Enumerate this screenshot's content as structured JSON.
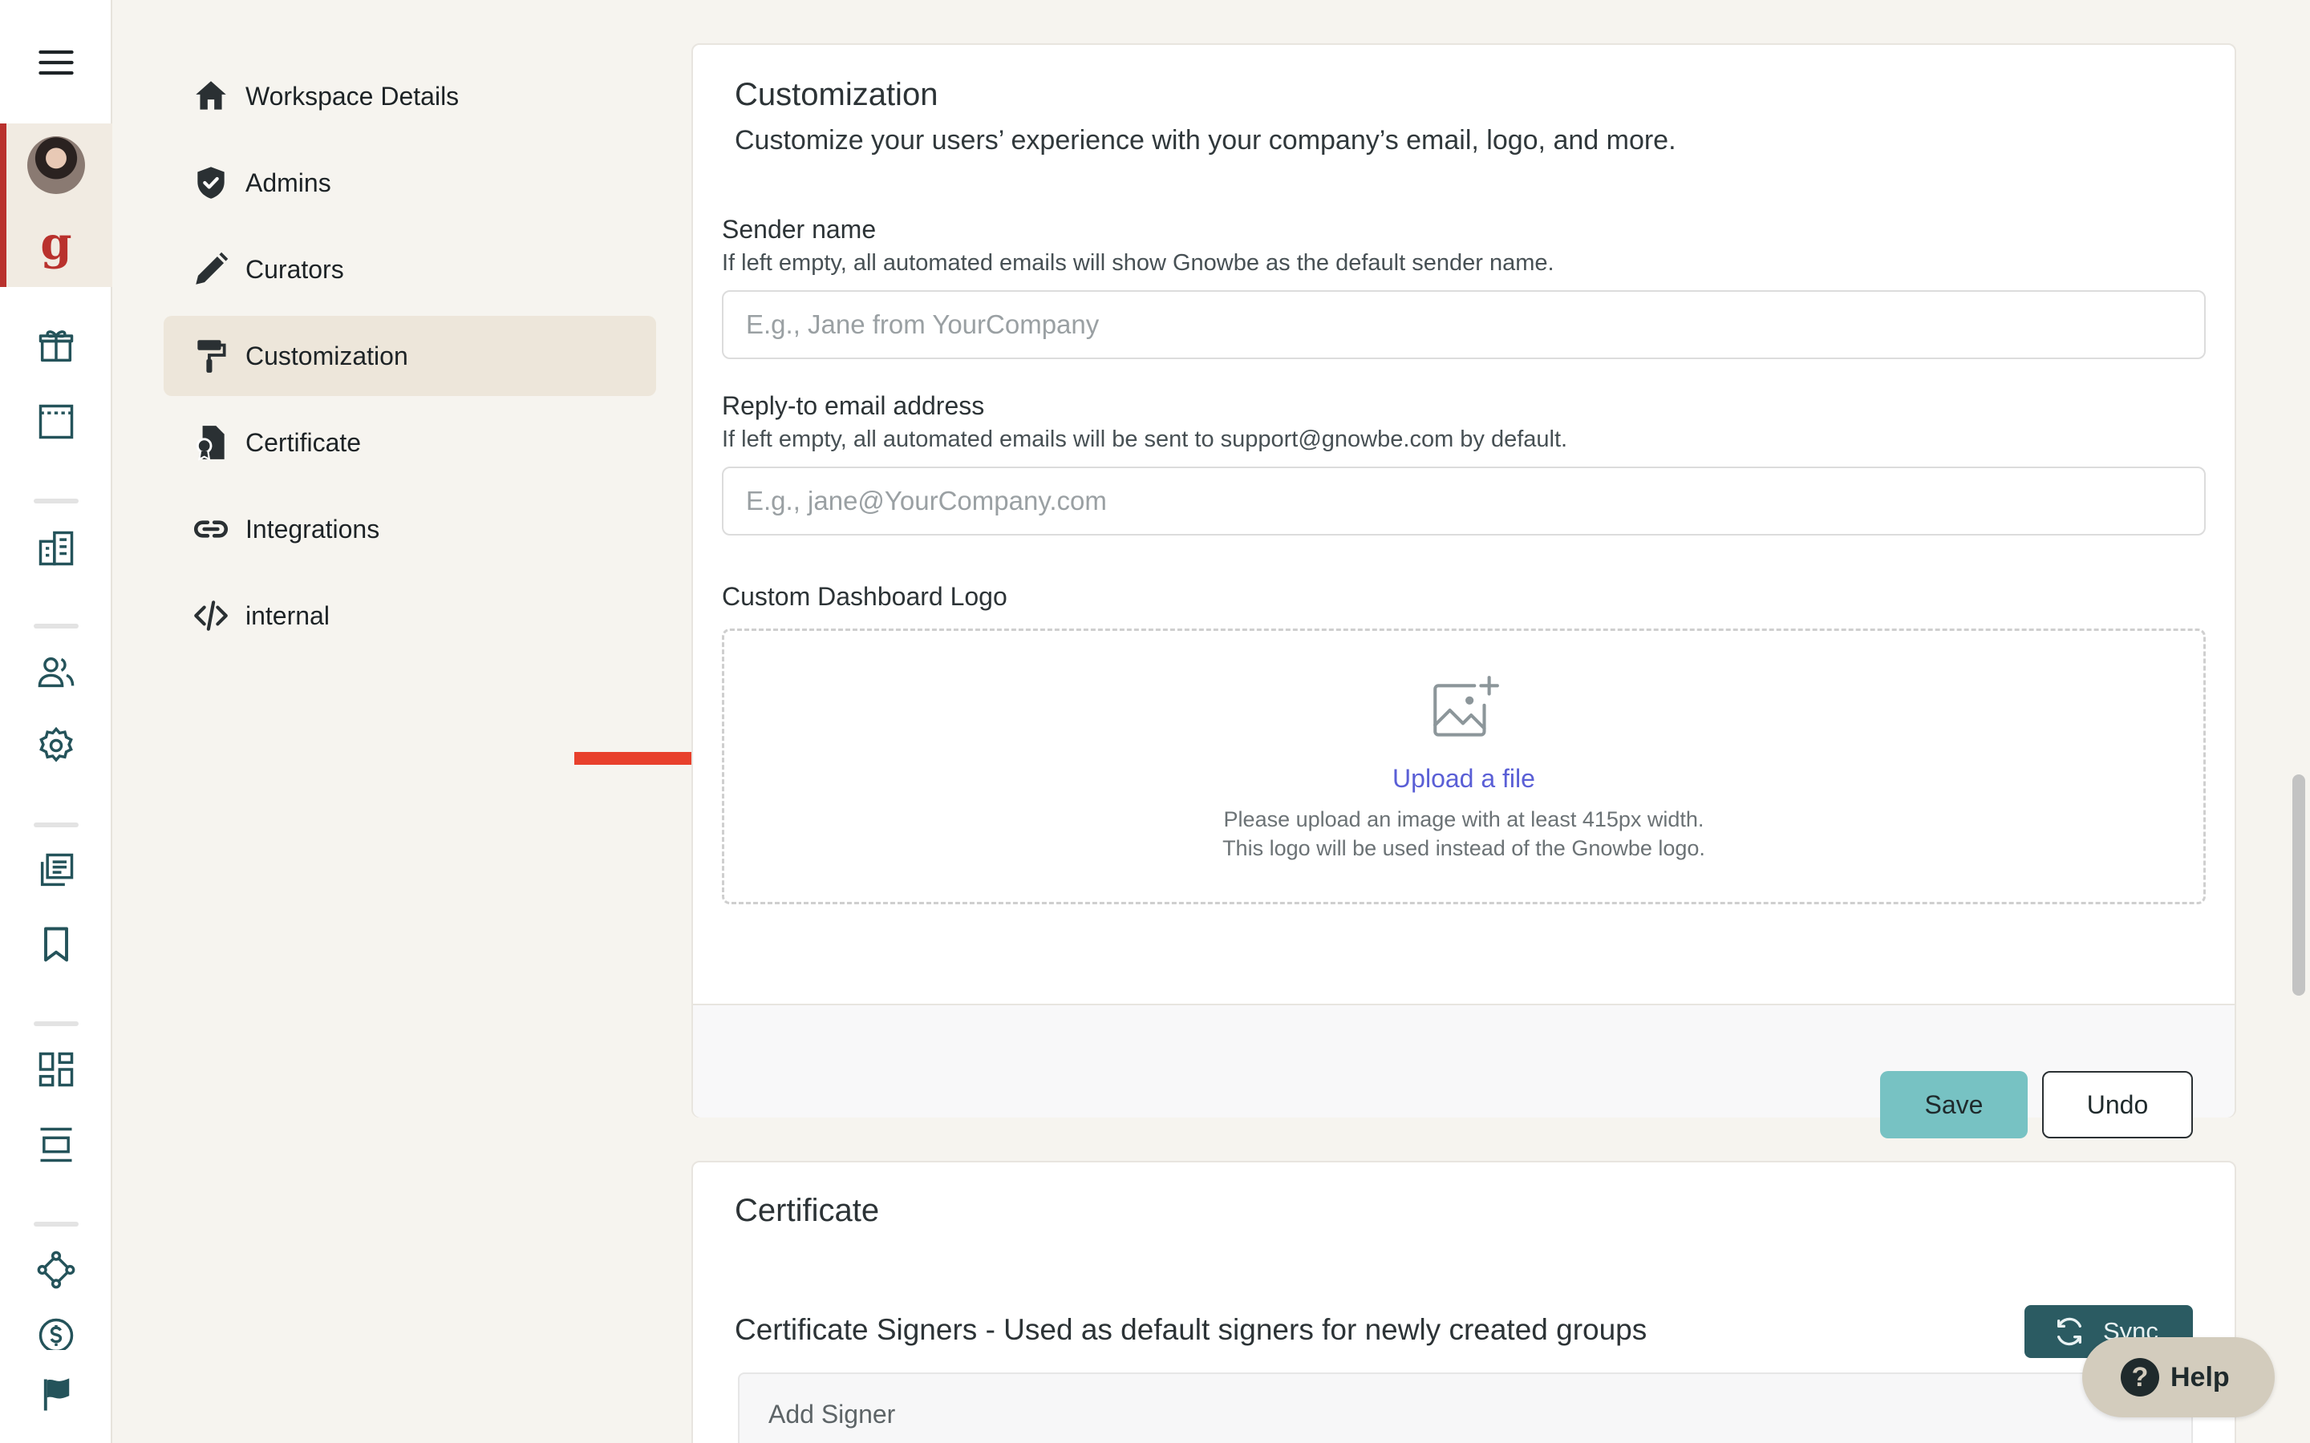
{
  "rail": {
    "icons": [
      "menu-icon",
      "avatar",
      "gnowbe-logo",
      "gift-icon",
      "layout-icon",
      "buildings-icon",
      "users-icon",
      "settings-icon",
      "library-icon",
      "bookmark-icon",
      "dashboard-icon",
      "content-icon",
      "network-icon",
      "billing-icon",
      "flag-icon"
    ],
    "brand_letter": "g"
  },
  "settings_nav": {
    "items": [
      {
        "label": "Workspace Details",
        "icon": "home-icon"
      },
      {
        "label": "Admins",
        "icon": "shield-icon"
      },
      {
        "label": "Curators",
        "icon": "pencil-icon"
      },
      {
        "label": "Customization",
        "icon": "paint-roller-icon",
        "active": true
      },
      {
        "label": "Certificate",
        "icon": "certificate-icon"
      },
      {
        "label": "Integrations",
        "icon": "link-icon"
      },
      {
        "label": "internal",
        "icon": "code-icon"
      }
    ]
  },
  "customization": {
    "title": "Customization",
    "subtitle": "Customize your users’ experience with your company’s email, logo, and more.",
    "sender_name": {
      "label": "Sender name",
      "help": "If left empty, all automated emails will show Gnowbe as the default sender name.",
      "placeholder": "E.g., Jane from YourCompany",
      "value": ""
    },
    "reply_to": {
      "label": "Reply-to email address",
      "help": "If left empty, all automated emails will be sent to support@gnowbe.com by default.",
      "placeholder": "E.g., jane@YourCompany.com",
      "value": ""
    },
    "logo": {
      "label": "Custom Dashboard Logo",
      "upload_link": "Upload a file",
      "hint_line1": "Please upload an image with at least 415px width.",
      "hint_line2": "This logo will be used instead of the Gnowbe logo."
    },
    "save_label": "Save",
    "undo_label": "Undo"
  },
  "certificate": {
    "title": "Certificate",
    "signers_heading": "Certificate Signers - Used as default signers for newly created groups",
    "sync_label": "Sync",
    "add_signer_label": "Add Signer"
  },
  "help": {
    "label": "Help",
    "glyph": "?"
  },
  "colors": {
    "accent_red": "#b9312d",
    "icon_teal": "#24535a",
    "save_button": "#77c2c3",
    "sync_button": "#2b5b62",
    "link": "#5a5fd6",
    "annotation_arrow": "#e8402c"
  }
}
